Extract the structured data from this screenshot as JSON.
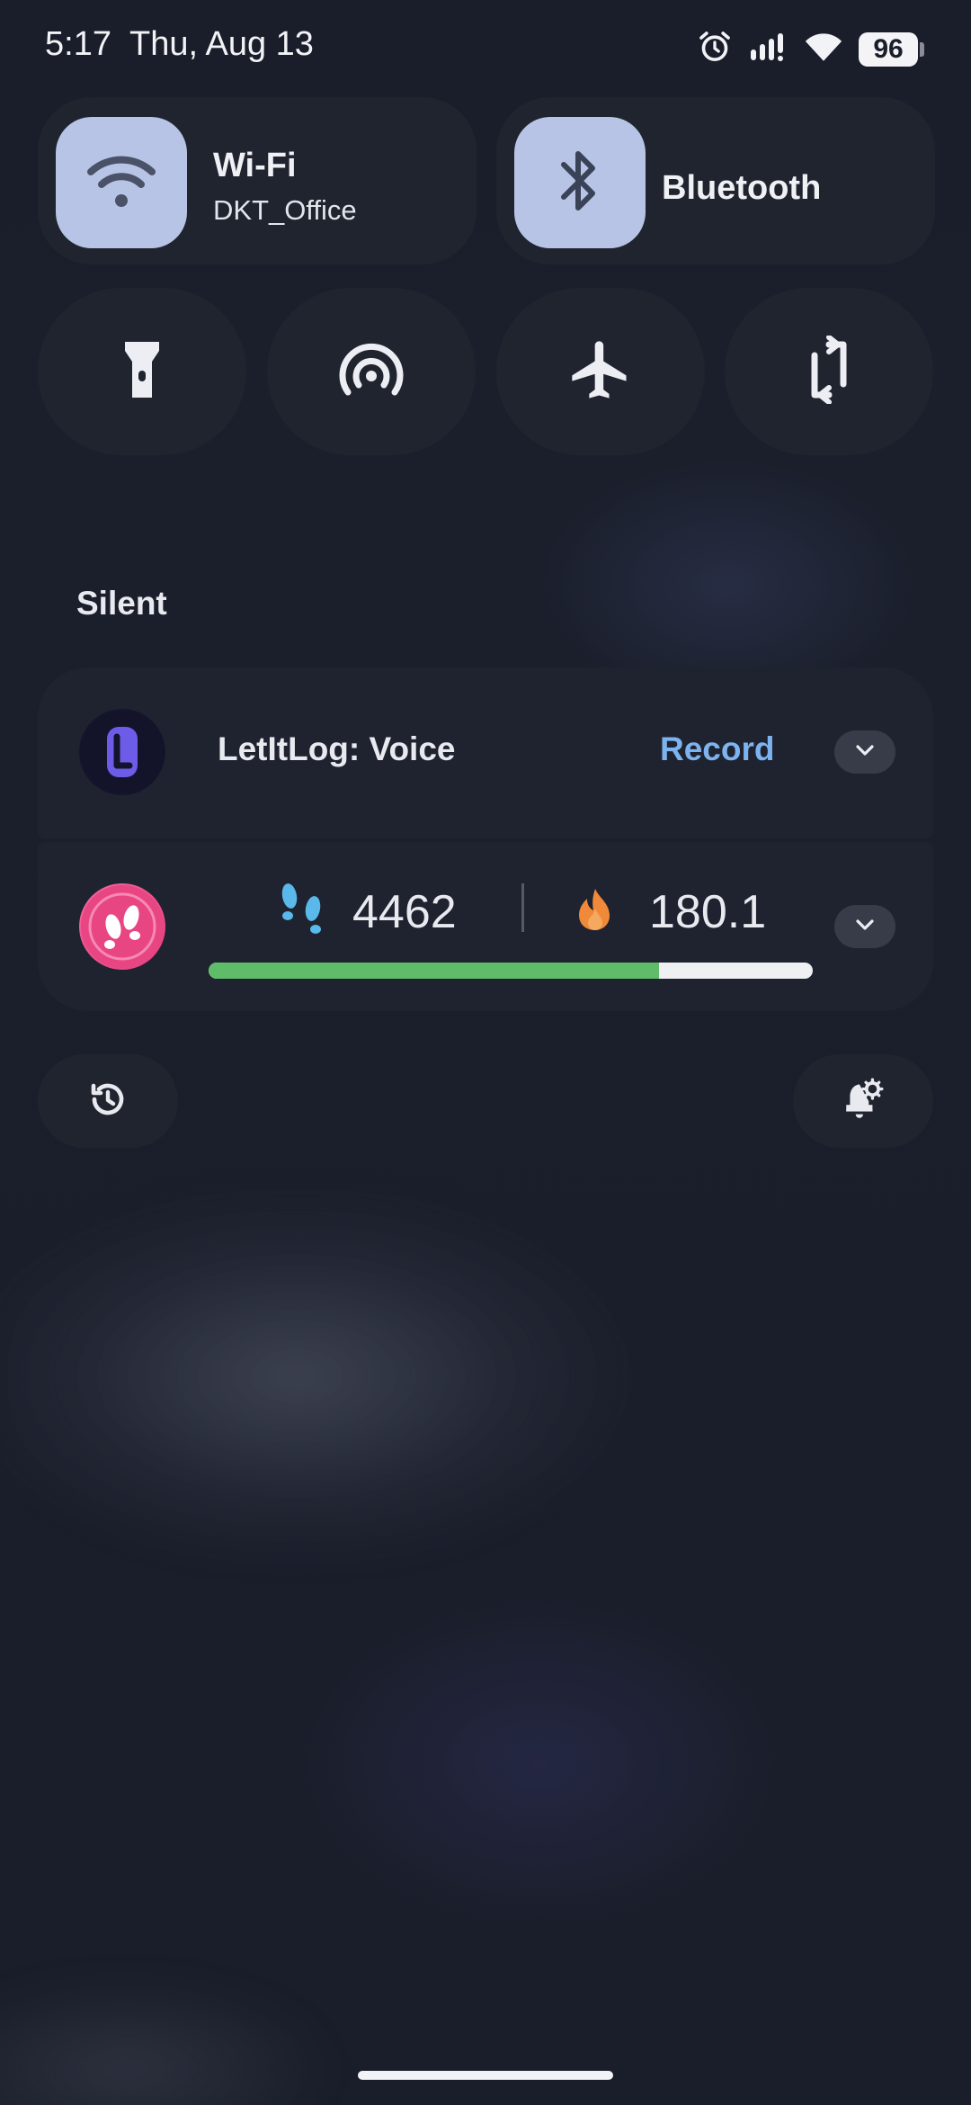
{
  "status_bar": {
    "time": "5:17",
    "date": "Thu, Aug 13",
    "battery": "96",
    "icons": [
      "alarm-icon",
      "signal-icon",
      "wifi-icon",
      "battery-icon"
    ]
  },
  "quick_settings": {
    "wifi": {
      "title": "Wi-Fi",
      "subtitle": "DKT_Office",
      "icon": "wifi-icon"
    },
    "bluetooth": {
      "title": "Bluetooth",
      "icon": "bluetooth-icon"
    },
    "small_tiles": [
      "flashlight-icon",
      "hotspot-icon",
      "airplane-icon",
      "auto-rotate-icon"
    ]
  },
  "notifications": {
    "section_label": "Silent",
    "items": [
      {
        "app_icon": "letitlog-icon",
        "title": "LetItLog: Voice",
        "action": "Record"
      },
      {
        "app_icon": "steps-app-icon",
        "steps": "4462",
        "calories": "180.1",
        "progress": 0.745,
        "colors": {
          "progress": "#5fbd6a",
          "steps_icon": "#5ab8ea",
          "fire_icon": "#f08a3a"
        }
      }
    ]
  },
  "bottom_actions": [
    "history-icon",
    "notification-settings-icon"
  ],
  "colors": {
    "accent": "#b8c4e6",
    "action_text": "#7db3ee"
  }
}
